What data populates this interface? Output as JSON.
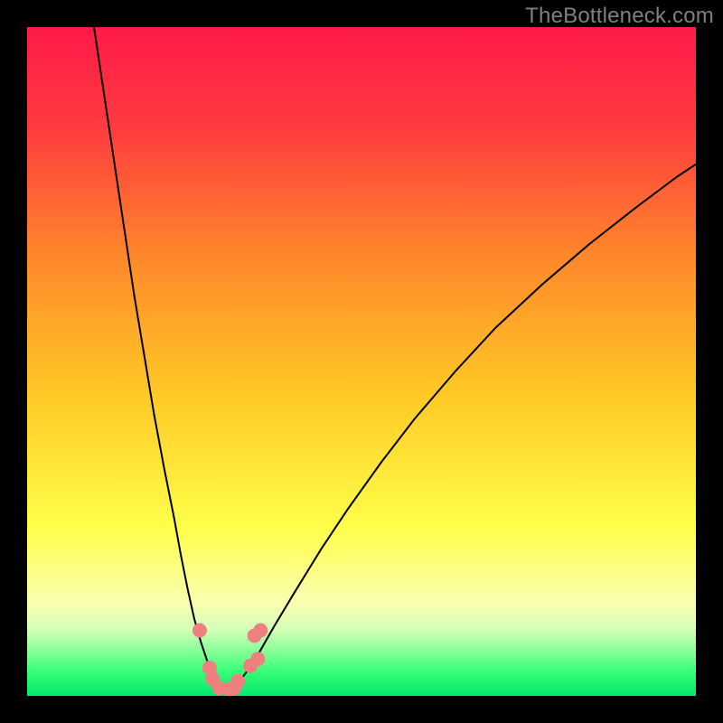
{
  "watermark": "TheBottleneck.com",
  "chart_data": {
    "type": "line",
    "title": "",
    "xlabel": "",
    "ylabel": "",
    "xlim": [
      0,
      100
    ],
    "ylim": [
      0,
      100
    ],
    "grid": false,
    "legend": false,
    "background_gradient": {
      "stops": [
        {
          "offset": 0.0,
          "color": "#ff1a4a"
        },
        {
          "offset": 0.15,
          "color": "#ff3b3f"
        },
        {
          "offset": 0.35,
          "color": "#ff8a2a"
        },
        {
          "offset": 0.55,
          "color": "#ffc926"
        },
        {
          "offset": 0.75,
          "color": "#ffff4a"
        },
        {
          "offset": 0.86,
          "color": "#faffb0"
        },
        {
          "offset": 0.9,
          "color": "#d4ffb8"
        },
        {
          "offset": 0.93,
          "color": "#8fff9c"
        },
        {
          "offset": 0.96,
          "color": "#3fff7a"
        },
        {
          "offset": 1.0,
          "color": "#00e86b"
        }
      ]
    },
    "series": [
      {
        "name": "left-curve",
        "stroke": "#000000",
        "x": [
          10.0,
          11.5,
          13.0,
          14.5,
          16.0,
          17.5,
          19.0,
          20.5,
          22.0,
          23.0,
          24.0,
          25.0,
          26.0,
          27.0,
          28.0,
          28.5,
          29.0,
          29.5
        ],
        "y": [
          100.0,
          90.0,
          80.0,
          70.0,
          60.0,
          51.0,
          42.0,
          34.0,
          26.5,
          21.0,
          16.0,
          11.5,
          8.0,
          5.0,
          2.8,
          2.0,
          1.4,
          1.0
        ]
      },
      {
        "name": "right-curve",
        "stroke": "#000000",
        "x": [
          30.5,
          31.0,
          32.0,
          33.5,
          35.0,
          37.0,
          40.0,
          44.0,
          48.0,
          53.0,
          58.0,
          64.0,
          70.0,
          77.0,
          84.0,
          91.0,
          97.0,
          100.0
        ],
        "y": [
          1.0,
          1.4,
          2.5,
          4.5,
          7.0,
          10.5,
          15.5,
          22.0,
          28.0,
          35.0,
          41.5,
          48.5,
          55.0,
          61.5,
          67.5,
          73.0,
          77.5,
          79.5
        ]
      },
      {
        "name": "floor-line",
        "stroke": "#000000",
        "x": [
          29.5,
          30.5
        ],
        "y": [
          1.0,
          1.0
        ]
      }
    ],
    "scatter": {
      "name": "markers",
      "color": "#f08080",
      "points": [
        {
          "x": 25.8,
          "y": 9.8
        },
        {
          "x": 27.3,
          "y": 4.2
        },
        {
          "x": 27.7,
          "y": 2.6
        },
        {
          "x": 28.7,
          "y": 1.2
        },
        {
          "x": 30.2,
          "y": 1.0
        },
        {
          "x": 31.0,
          "y": 1.2
        },
        {
          "x": 31.5,
          "y": 2.2
        },
        {
          "x": 33.4,
          "y": 4.5
        },
        {
          "x": 34.5,
          "y": 5.5
        },
        {
          "x": 34.0,
          "y": 9.0
        },
        {
          "x": 34.9,
          "y": 9.8
        }
      ]
    }
  }
}
